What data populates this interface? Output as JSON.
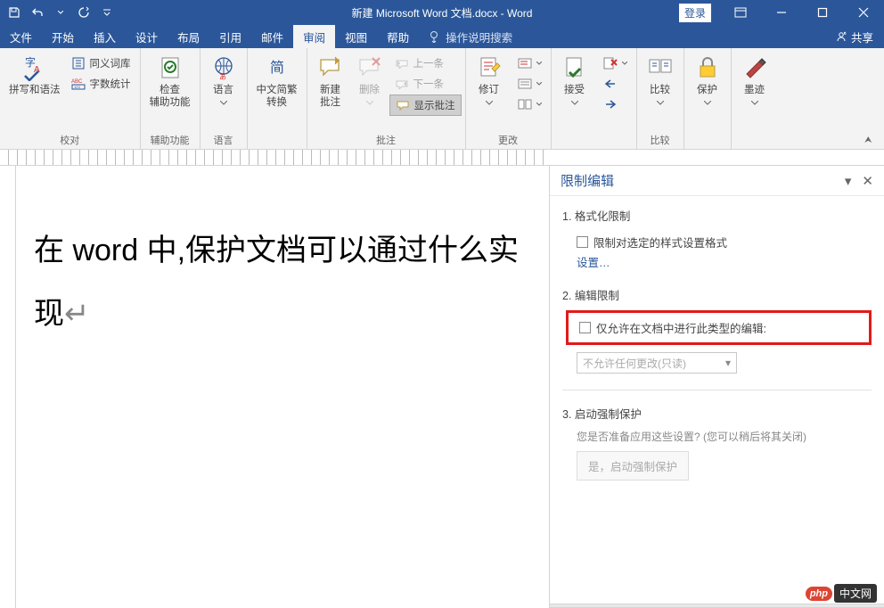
{
  "title": "新建 Microsoft Word 文档.docx  -  Word",
  "login": "登录",
  "tabs": [
    "文件",
    "开始",
    "插入",
    "设计",
    "布局",
    "引用",
    "邮件",
    "审阅",
    "视图",
    "帮助"
  ],
  "tab_active_index": 7,
  "tell_me": "操作说明搜索",
  "share": "共享",
  "ribbon": {
    "proofing": {
      "label": "校对",
      "spelling": "拼写和语法",
      "thesaurus": "同义词库",
      "wordcount": "字数统计"
    },
    "accessibility": {
      "label": "辅助功能",
      "check": "检查\n辅助功能"
    },
    "language": {
      "label": "语言",
      "btn": "语言"
    },
    "chinese": {
      "label": "中文简繁\n转换",
      "btn": "中文简繁\n转换"
    },
    "comments": {
      "label": "批注",
      "new": "新建\n批注",
      "delete": "删除",
      "prev": "上一条",
      "next": "下一条",
      "show": "显示批注"
    },
    "tracking": {
      "label": "更改",
      "track": "修订",
      "accept": "接受"
    },
    "compare": {
      "label": "比较",
      "btn": "比较"
    },
    "protect": {
      "label": "保护"
    },
    "ink": {
      "label": "墨迹"
    }
  },
  "document_text": "在 word 中,保护文档可以通过什么实现",
  "pane": {
    "title": "限制编辑",
    "s1": "1. 格式化限制",
    "s1_chk": "限制对选定的样式设置格式",
    "s1_link": "设置…",
    "s2": "2. 编辑限制",
    "s2_chk": "仅允许在文档中进行此类型的编辑:",
    "s2_dd": "不允许任何更改(只读)",
    "s3": "3. 启动强制保护",
    "s3_info": "您是否准备应用这些设置? (您可以稍后将其关闭)",
    "s3_btn": "是，启动强制保护"
  },
  "watermark": {
    "badge": "php",
    "text": "中文网"
  }
}
